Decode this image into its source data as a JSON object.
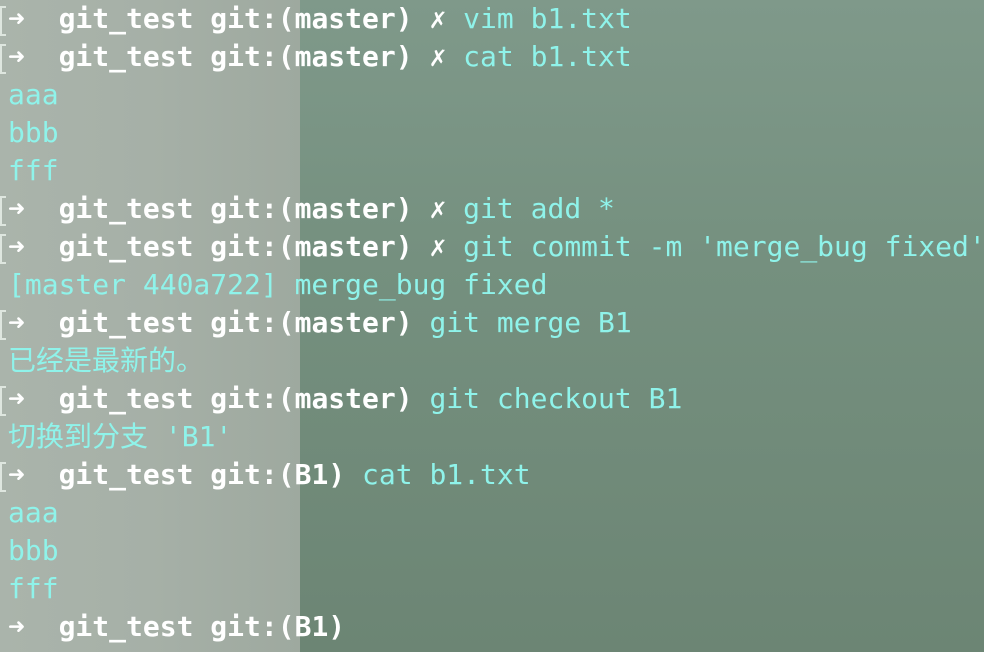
{
  "terminal": {
    "prompt_arrow": "➜",
    "prompt_dir": "git_test",
    "prompt_git": "git:(",
    "prompt_close": ")",
    "dirty_mark": "✗",
    "lines": [
      {
        "type": "prompt",
        "branch": "master",
        "dirty": true,
        "cmd": "vim b1.txt"
      },
      {
        "type": "prompt",
        "branch": "master",
        "dirty": true,
        "cmd": "cat b1.txt"
      },
      {
        "type": "output",
        "text": "aaa"
      },
      {
        "type": "output",
        "text": "bbb"
      },
      {
        "type": "output",
        "text": "fff"
      },
      {
        "type": "prompt",
        "branch": "master",
        "dirty": true,
        "cmd": "git add *"
      },
      {
        "type": "prompt",
        "branch": "master",
        "dirty": true,
        "cmd": "git commit -m 'merge_bug fixed'"
      },
      {
        "type": "output",
        "text": "[master 440a722] merge_bug fixed"
      },
      {
        "type": "prompt",
        "branch": "master",
        "dirty": false,
        "cmd": "git merge B1"
      },
      {
        "type": "output",
        "text": "已经是最新的。"
      },
      {
        "type": "prompt",
        "branch": "master",
        "dirty": false,
        "cmd": "git checkout B1"
      },
      {
        "type": "output",
        "text": "切换到分支 'B1'"
      },
      {
        "type": "prompt",
        "branch": "B1",
        "dirty": false,
        "cmd": "cat b1.txt"
      },
      {
        "type": "output",
        "text": "aaa"
      },
      {
        "type": "output",
        "text": "bbb"
      },
      {
        "type": "output",
        "text": "fff"
      },
      {
        "type": "prompt",
        "branch": "B1",
        "dirty": false,
        "cmd": "",
        "no_bracket": true
      }
    ]
  },
  "colors": {
    "command": "#8ff3ea",
    "prompt": "#ffffff",
    "background": "#6f8878"
  }
}
